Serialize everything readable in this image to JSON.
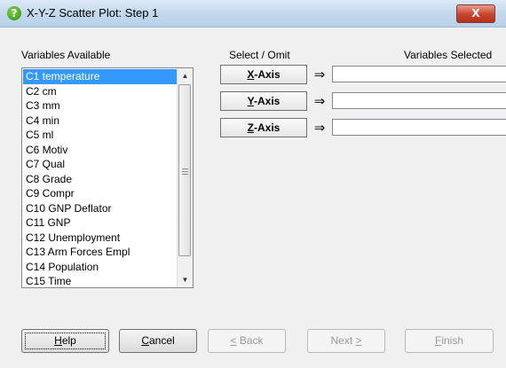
{
  "window": {
    "title": "X-Y-Z Scatter Plot: Step 1",
    "title_icon": "?",
    "close_label": "X"
  },
  "variables": {
    "header": "Variables Available",
    "items": [
      "C1 temperature",
      "C2 cm",
      "C3 mm",
      "C4 min",
      "C5 ml",
      "C6 Motiv",
      "C7 Qual",
      "C8 Grade",
      "C9 Compr",
      "C10 GNP Deflator",
      "C11 GNP",
      "C12 Unemployment",
      "C13 Arm Forces Empl",
      "C14 Population",
      "C15 Time"
    ],
    "selected_index": 0
  },
  "select_header": "Select / Omit",
  "selected_header": "Variables Selected",
  "axes": [
    {
      "mnemonic": "X",
      "rest": "-Axis",
      "arrow": "⇒",
      "value": ""
    },
    {
      "mnemonic": "Y",
      "rest": "-Axis",
      "arrow": "⇒",
      "value": ""
    },
    {
      "mnemonic": "Z",
      "rest": "-Axis",
      "arrow": "⇒",
      "value": ""
    }
  ],
  "buttons": {
    "help": {
      "mnemonic": "H",
      "rest": "elp"
    },
    "cancel": {
      "mnemonic": "C",
      "rest": "ancel"
    },
    "back": {
      "mnemonic": "<",
      "rest": " Back"
    },
    "next": {
      "prefix": "Next ",
      "mnemonic": ">"
    },
    "finish": {
      "mnemonic": "F",
      "rest": "inish"
    }
  },
  "colors": {
    "selection": "#3399ff",
    "close_button": "#c7432c",
    "window_bg": "#f0f0f0"
  }
}
